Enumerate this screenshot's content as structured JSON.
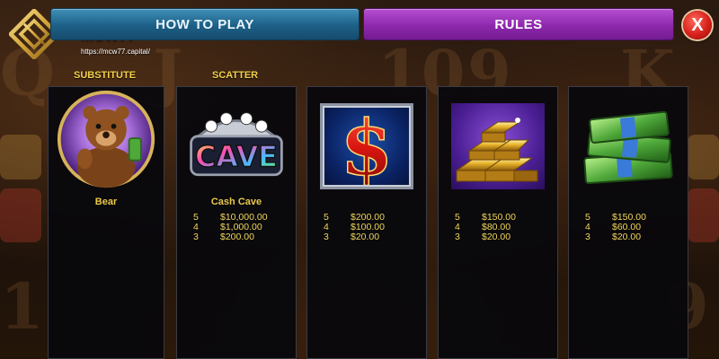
{
  "logo": {
    "name": "MCW77",
    "url": "https://mcw77.capital/"
  },
  "tabs": {
    "how_to_play": "HOW TO PLAY",
    "rules": "RULES",
    "close": "X"
  },
  "columns": [
    {
      "header": "SUBSTITUTE",
      "symbol": "Bear",
      "label": "Bear",
      "payouts": []
    },
    {
      "header": "SCATTER",
      "symbol": "Cash Cave logo",
      "label": "Cash Cave",
      "payouts": [
        {
          "count": "5",
          "amount": "$10,000.00"
        },
        {
          "count": "4",
          "amount": "$1,000.00"
        },
        {
          "count": "3",
          "amount": "$200.00"
        }
      ]
    },
    {
      "header": "",
      "symbol": "Dollar sign",
      "label": "",
      "payouts": [
        {
          "count": "5",
          "amount": "$200.00"
        },
        {
          "count": "4",
          "amount": "$100.00"
        },
        {
          "count": "3",
          "amount": "$20.00"
        }
      ]
    },
    {
      "header": "",
      "symbol": "Gold bars",
      "label": "",
      "payouts": [
        {
          "count": "5",
          "amount": "$150.00"
        },
        {
          "count": "4",
          "amount": "$80.00"
        },
        {
          "count": "3",
          "amount": "$20.00"
        }
      ]
    },
    {
      "header": "",
      "symbol": "Cash stacks",
      "label": "",
      "payouts": [
        {
          "count": "5",
          "amount": "$150.00"
        },
        {
          "count": "4",
          "amount": "$60.00"
        },
        {
          "count": "3",
          "amount": "$20.00"
        }
      ]
    }
  ],
  "icons": {
    "bear": "bear-symbol-icon",
    "cash_cave": "cash-cave-symbol-icon",
    "dollar": "dollar-symbol-icon",
    "gold": "gold-bars-symbol-icon",
    "cash": "cash-stack-symbol-icon",
    "close": "close-icon"
  },
  "colors": {
    "how_to_play_tab": "#1d5f86",
    "rules_tab": "#8e28ad",
    "close_button": "#d6201b",
    "paytable_text": "#f0d55a",
    "header_text": "#f2d14a"
  }
}
